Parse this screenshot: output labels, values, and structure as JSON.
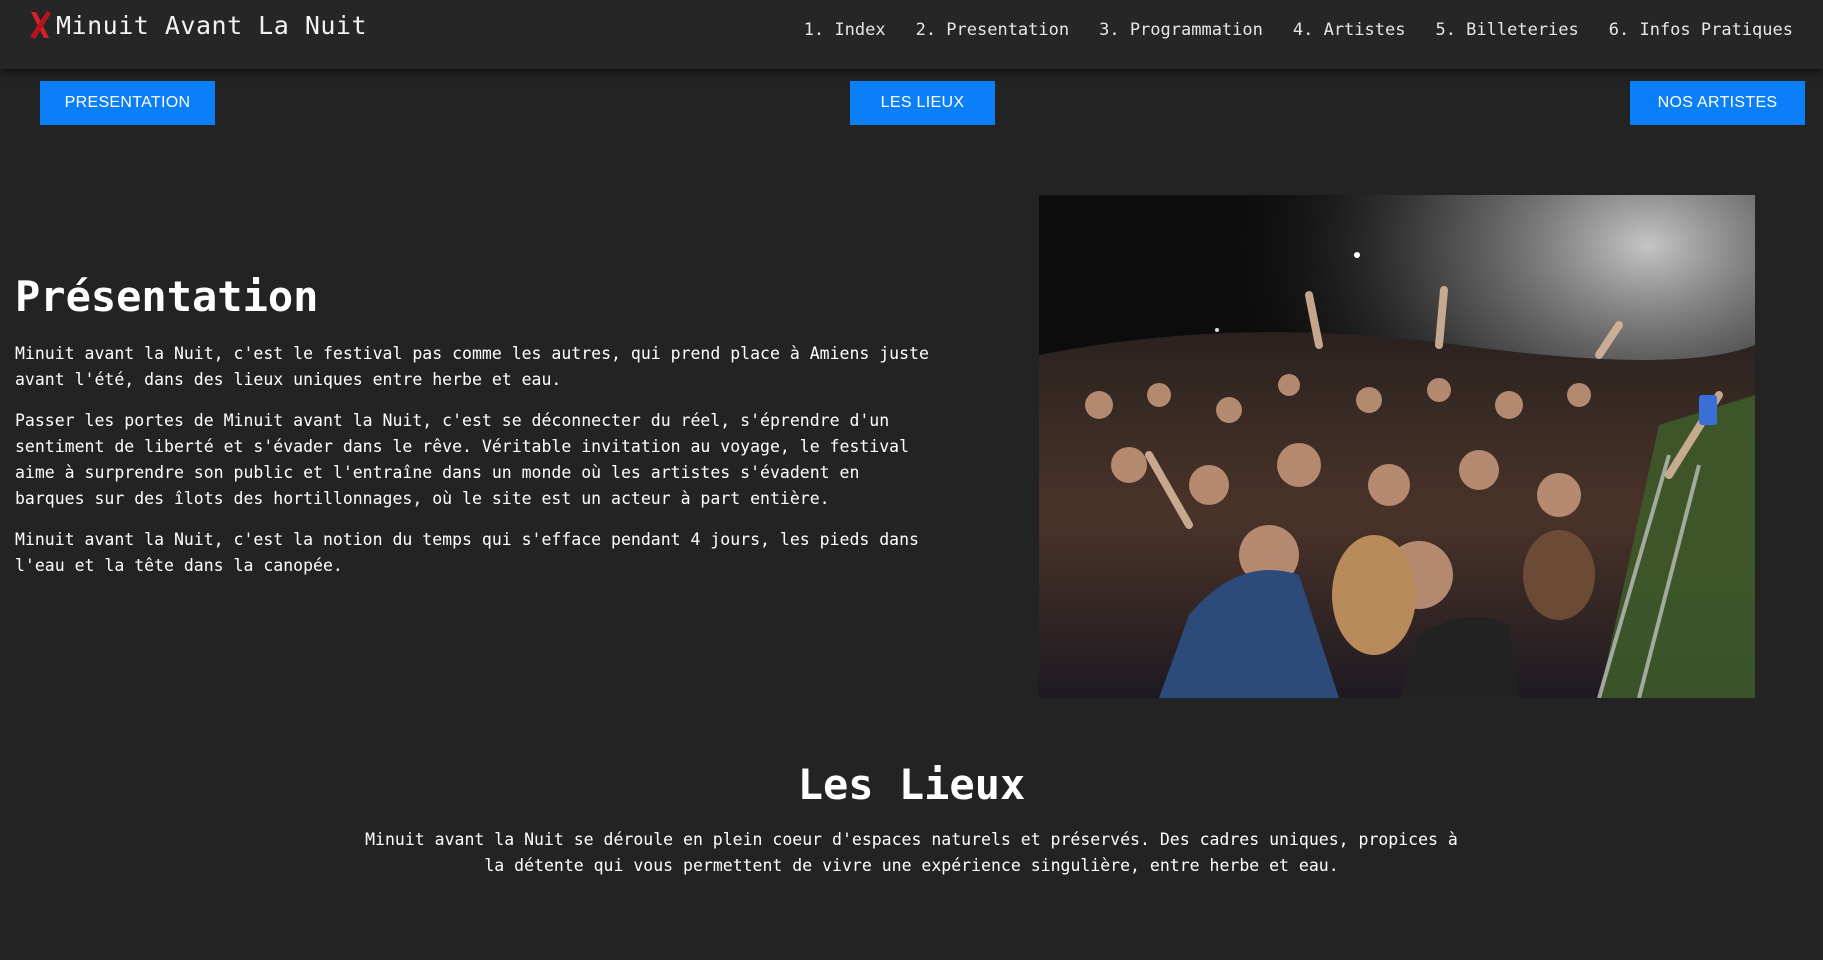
{
  "header": {
    "logo_icon": "red-x-icon",
    "brand_title": "Minuit Avant La Nuit",
    "nav": [
      {
        "label": "1. Index"
      },
      {
        "label": "2. Presentation"
      },
      {
        "label": "3. Programmation"
      },
      {
        "label": "4. Artistes"
      },
      {
        "label": "5. Billeteries"
      },
      {
        "label": "6. Infos Pratiques"
      }
    ]
  },
  "subnav": {
    "presentation": "PRESENTATION",
    "lieux": "LES LIEUX",
    "artistes": "NOS ARTISTES"
  },
  "presentation": {
    "title": "Présentation",
    "paragraphs": [
      "Minuit avant la Nuit, c'est le festival pas comme les autres, qui prend place à Amiens juste avant l'été, dans des lieux uniques entre herbe et eau.",
      "Passer les portes de Minuit avant la Nuit, c'est se déconnecter du réel, s'éprendre d'un sentiment de liberté et s'évader dans le rêve. Véritable invitation au voyage, le festival aime à surprendre son public et l'entraîne dans un monde où les artistes s'évadent en barques sur des îlots des hortillonnages, où le site est un acteur à part entière.",
      "Minuit avant la Nuit, c'est la notion du temps qui s'efface pendant 4 jours, les pieds dans l'eau et la tête dans la canopée."
    ]
  },
  "lieux": {
    "title": "Les Lieux",
    "text": "Minuit avant la Nuit se déroule en plein coeur d'espaces naturels et préservés. Des cadres uniques, propices à la détente qui vous permettent de vivre une expérience singulière, entre herbe et eau."
  },
  "colors": {
    "background": "#232323",
    "header": "#262626",
    "accent_blue": "#0a7ff8",
    "logo_red": "#d9202a"
  }
}
